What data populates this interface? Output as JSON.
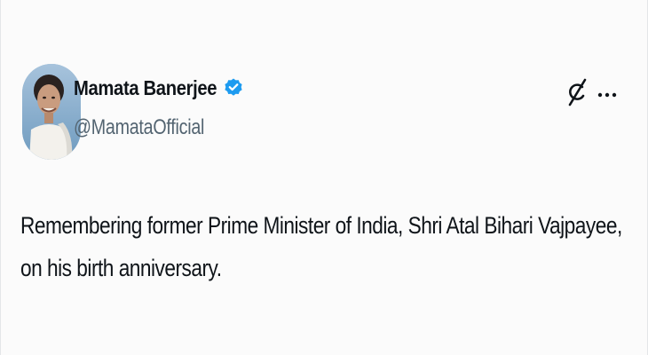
{
  "tweet": {
    "author": {
      "display_name": "Mamata Banerjee",
      "handle": "@MamataOfficial",
      "verified_icon": "verified-badge-icon",
      "verified_color": "#1d9bf0"
    },
    "actions": {
      "grok_icon": "grok-icon",
      "more_icon": "more-options-icon"
    },
    "text_lines": [
      "Remembering former Prime Minister of India, Shri Atal Bihari Vajpayee,",
      "on his birth anniversary."
    ]
  },
  "colors": {
    "background": "#fbfbfb",
    "text_primary": "#0f1419",
    "text_secondary": "#536471"
  }
}
